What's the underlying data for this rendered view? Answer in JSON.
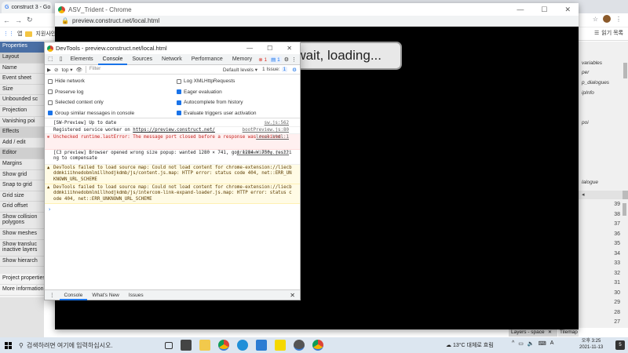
{
  "bg_chrome": {
    "tab_title": "construct 3 - Go",
    "bookmarks": [
      "앱",
      "지원사인"
    ],
    "reading_list": "읽기 목록"
  },
  "props_panel": {
    "title": "Properties",
    "rows": [
      {
        "label": "Layout",
        "type": "sec"
      },
      {
        "label": "Name",
        "type": "row"
      },
      {
        "label": "Event sheet",
        "type": "row"
      },
      {
        "label": "Size",
        "type": "row"
      },
      {
        "label": "Unbounded sc",
        "type": "row"
      },
      {
        "label": "Projection",
        "type": "row"
      },
      {
        "label": "Vanishing poi",
        "type": "row"
      },
      {
        "label": "Effects",
        "type": "sec"
      },
      {
        "label": "Add / edit",
        "type": "row"
      },
      {
        "label": "Editor",
        "type": "sec"
      },
      {
        "label": "Margins",
        "type": "row"
      },
      {
        "label": "Show grid",
        "type": "row"
      },
      {
        "label": "Snap to grid",
        "type": "row"
      },
      {
        "label": "Grid size",
        "type": "row"
      },
      {
        "label": "Grid offset",
        "type": "row"
      },
      {
        "label": "Show collision polygons",
        "type": "row"
      },
      {
        "label": "Show meshes",
        "type": "row"
      },
      {
        "label": "Show transluc inactive layers",
        "type": "row"
      },
      {
        "label": "Show hierarch",
        "type": "row"
      }
    ],
    "footer": [
      "Project properties",
      "More information"
    ]
  },
  "right_panel": {
    "items": [
      "variables",
      "per",
      "p_dialogues",
      "ipInfo",
      "poi",
      "lalogue"
    ],
    "numbers": [
      "39",
      "38",
      "37",
      "36",
      "35",
      "34",
      "33",
      "32",
      "31",
      "30",
      "29",
      "28",
      "27"
    ],
    "layers_tab": "Layers - space",
    "tilemap_tab": "Tilemap"
  },
  "preview": {
    "title": "ASV_Trident - Chrome",
    "url": "preview.construct.net/local.html",
    "loading_text": "wait, loading..."
  },
  "devtools": {
    "title": "DevTools - preview.construct.net/local.html",
    "tabs": [
      "Elements",
      "Console",
      "Sources",
      "Network",
      "Performance",
      "Memory"
    ],
    "active_tab": "Console",
    "error_count": "1",
    "message_count": "1",
    "context": "top",
    "filter_placeholder": "Filter",
    "levels": "Default levels",
    "issues": "1 Issue:",
    "issues_count": "1",
    "settings_left": [
      {
        "label": "Hide network",
        "checked": false
      },
      {
        "label": "Preserve log",
        "checked": false
      },
      {
        "label": "Selected context only",
        "checked": false
      },
      {
        "label": "Group similar messages in console",
        "checked": true
      }
    ],
    "settings_right": [
      {
        "label": "Log XMLHttpRequests",
        "checked": false
      },
      {
        "label": "Eager evaluation",
        "checked": true
      },
      {
        "label": "Autocomplete from history",
        "checked": true
      },
      {
        "label": "Evaluate triggers user activation",
        "checked": true
      }
    ],
    "messages": [
      {
        "text": "[SW-Preview] Up to date",
        "source": "sw.js:562",
        "kind": "log"
      },
      {
        "text": "Registered service worker on ",
        "link": "https://preview.construct.net/",
        "source": "bootPreview.js:80",
        "kind": "log"
      },
      {
        "text": "Unchecked runtime.lastError: The message port closed before a response was received.",
        "source": "local.html:1",
        "kind": "err"
      },
      {
        "text": "[C3 preview] Browser opened wrong size popup: wanted 1280 × 741, got 1284 × 750; resizing to compensate",
        "source": "previewWindow.js:22",
        "kind": "log"
      },
      {
        "text": "DevTools failed to load source map: Could not load content for chrome-extension://liecbddmkiiihnedobmlmillhodjkdmb/js/content.js.map: HTTP error: status code 404, net::ERR_UNKNOWN_URL_SCHEME",
        "kind": "warn"
      },
      {
        "text": "DevTools failed to load source map: Could not load content for chrome-extension://liecbddmkiiihnedobmlmillhodjkdmb/js/intercom-link-expand-loader.js.map: HTTP error: status code 404, net::ERR_UNKNOWN_URL_SCHEME",
        "kind": "warn"
      }
    ],
    "drawer_tabs": [
      "Console",
      "What's New",
      "Issues"
    ]
  },
  "taskbar": {
    "search_placeholder": "검색하려면 여기에 입력하십시오.",
    "weather": "13°C 대체로 흐림",
    "lang": "A",
    "time": "오후 3:25",
    "date": "2021-11-13",
    "notifications": "5"
  }
}
